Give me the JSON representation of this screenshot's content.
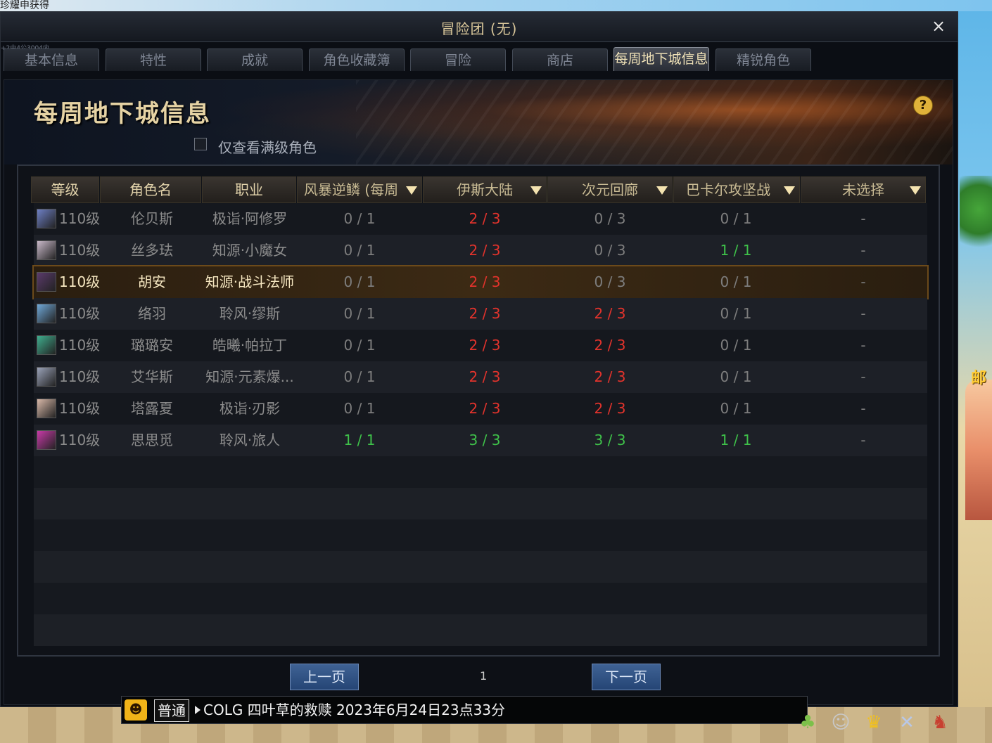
{
  "background": {
    "top_text": "珍耀申获得",
    "side_text": "邮"
  },
  "window": {
    "title": "冒险团 (无)",
    "subtext": "+2由4公3004内",
    "close_glyph": "×"
  },
  "tabs": [
    {
      "label": "基本信息",
      "active": false
    },
    {
      "label": "特性",
      "active": false
    },
    {
      "label": "成就",
      "active": false
    },
    {
      "label": "角色收藏簿",
      "active": false
    },
    {
      "label": "冒险",
      "active": false
    },
    {
      "label": "商店",
      "active": false
    },
    {
      "label": "每周地下城信息",
      "active": true
    },
    {
      "label": "精锐角色",
      "active": false
    }
  ],
  "panel": {
    "title": "每周地下城信息",
    "help_glyph": "?",
    "filter_label": "仅查看满级角色",
    "filter_checked": false
  },
  "table": {
    "headers": {
      "level": "等级",
      "name": "角色名",
      "job": "职业",
      "d1": "风暴逆鳞 (每周",
      "d2": "伊斯大陆",
      "d3": "次元回廊",
      "d4": "巴卡尔攻坚战",
      "d5": "未选择"
    },
    "rows": [
      {
        "level": "110级",
        "name": "伦贝斯",
        "job": "极诣·阿修罗",
        "d1": "0 / 1",
        "d2": "2 / 3",
        "d3": "0 / 3",
        "d4": "0 / 1",
        "d5": "-",
        "avatar_color": "#6d7fc4",
        "selected": false
      },
      {
        "level": "110级",
        "name": "丝多珐",
        "job": "知源·小魔女",
        "d1": "0 / 1",
        "d2": "2 / 3",
        "d3": "0 / 3",
        "d4": "1 / 1",
        "d5": "-",
        "avatar_color": "#c9b9c9",
        "selected": false
      },
      {
        "level": "110级",
        "name": "胡安",
        "job": "知源·战斗法师",
        "d1": "0 / 1",
        "d2": "2 / 3",
        "d3": "0 / 3",
        "d4": "0 / 1",
        "d5": "-",
        "avatar_color": "#5a3a6a",
        "selected": true
      },
      {
        "level": "110级",
        "name": "络羽",
        "job": "聆风·缪斯",
        "d1": "0 / 1",
        "d2": "2 / 3",
        "d3": "2 / 3",
        "d4": "0 / 1",
        "d5": "-",
        "avatar_color": "#6fa8d8",
        "selected": false
      },
      {
        "level": "110级",
        "name": "璐璐安",
        "job": "皓曦·帕拉丁",
        "d1": "0 / 1",
        "d2": "2 / 3",
        "d3": "2 / 3",
        "d4": "0 / 1",
        "d5": "-",
        "avatar_color": "#3fae8e",
        "selected": false
      },
      {
        "level": "110级",
        "name": "艾华斯",
        "job": "知源·元素爆...",
        "d1": "0 / 1",
        "d2": "2 / 3",
        "d3": "2 / 3",
        "d4": "0 / 1",
        "d5": "-",
        "avatar_color": "#9aa2b8",
        "selected": false
      },
      {
        "level": "110级",
        "name": "塔露夏",
        "job": "极诣·刃影",
        "d1": "0 / 1",
        "d2": "2 / 3",
        "d3": "2 / 3",
        "d4": "0 / 1",
        "d5": "-",
        "avatar_color": "#d8b8a8",
        "selected": false
      },
      {
        "level": "110级",
        "name": "思思觅",
        "job": "聆风·旅人",
        "d1": "1 / 1",
        "d2": "3 / 3",
        "d3": "3 / 3",
        "d4": "1 / 1",
        "d5": "-",
        "avatar_color": "#c83aa8",
        "selected": false
      }
    ],
    "empty_rows": 6
  },
  "pager": {
    "prev_label": "上一页",
    "next_label": "下一页",
    "page": "1"
  },
  "chat": {
    "icon_glyph": "☻",
    "channel": "普通",
    "message": "COLG 四叶草的救赎 2023年6月24日23点33分"
  },
  "hud_icons": [
    {
      "name": "sprout-icon",
      "glyph": "♣",
      "color": "#7cc04a"
    },
    {
      "name": "character-portrait-icon",
      "glyph": "☺",
      "color": "#c8c8c8"
    },
    {
      "name": "crown-icon",
      "glyph": "♛",
      "color": "#f0c020"
    },
    {
      "name": "bow-icon",
      "glyph": "✕",
      "color": "#b8c8e8"
    },
    {
      "name": "demon-mask-icon",
      "glyph": "♞",
      "color": "#c84030"
    }
  ],
  "colors": {
    "incomplete": "#e2332c",
    "complete": "#3fc24a",
    "untouched": "#7d7d7d",
    "accent_gold": "#e6d3a4"
  }
}
